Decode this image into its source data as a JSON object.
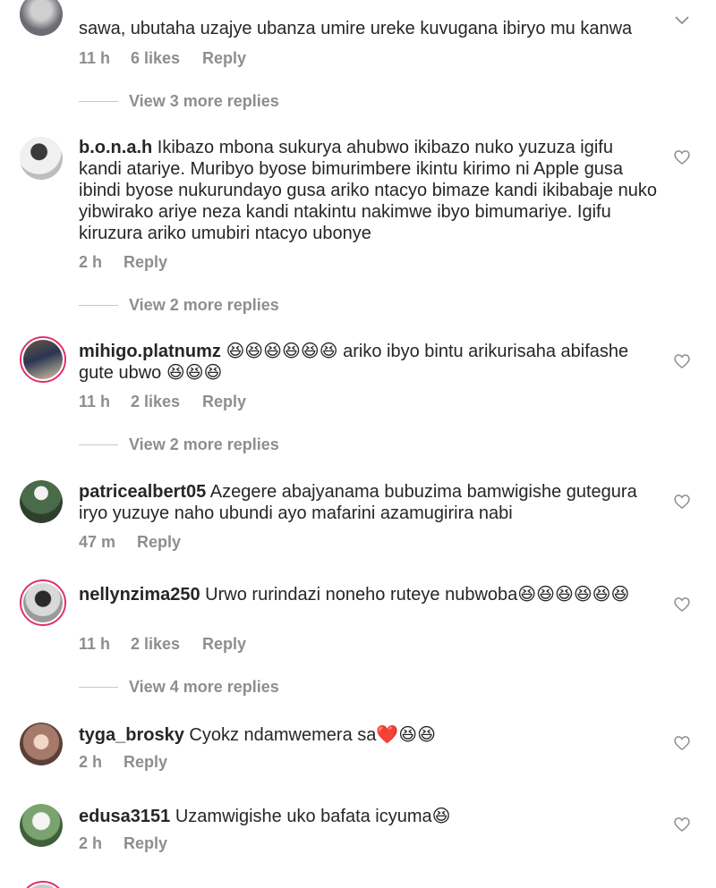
{
  "comments": [
    {
      "username": "",
      "text": "sawa, ubutaha uzajye ubanza umire ureke kuvugana ibiryo mu kanwa",
      "time": "11 h",
      "likes": "6 likes",
      "reply": "Reply",
      "more_replies": "View 3 more replies"
    },
    {
      "username": "b.o.n.a.h",
      "text": " Ikibazo mbona sukurya ahubwo ikibazo nuko yuzuza igifu kandi atariye. Muribyo byose bimurimbere ikintu kirimo ni Apple gusa ibindi byose nukurundayo gusa ariko ntacyo bimaze kandi ikibabaje nuko yibwirako ariye neza kandi ntakintu nakimwe ibyo bimumariye. Igifu kiruzura ariko umubiri ntacyo ubonye",
      "time": "2 h",
      "likes": "",
      "reply": "Reply",
      "more_replies": "View 2 more replies"
    },
    {
      "username": "mihigo.platnumz",
      "text": " 😆😆😆😆😆😆 ariko ibyo bintu arikurisaha abifashe gute ubwo 😆😆😆",
      "time": "11 h",
      "likes": "2 likes",
      "reply": "Reply",
      "more_replies": "View 2 more replies"
    },
    {
      "username": "patricealbert05",
      "text": " Azegere abajyanama bubuzima bamwigishe gutegura iryo yuzuye naho ubundi ayo mafarini azamugirira nabi",
      "time": "47 m",
      "likes": "",
      "reply": "Reply",
      "more_replies": ""
    },
    {
      "username": "nellynzima250",
      "text": " Urwo rurindazi noneho ruteye nubwoba😆😆😆😆😆😆",
      "time": "11 h",
      "likes": "2 likes",
      "reply": "Reply",
      "more_replies": "View 4 more replies"
    },
    {
      "username": "tyga_brosky",
      "text": " Cyokz ndamwemera sa❤️😆😆",
      "time": "2 h",
      "likes": "",
      "reply": "Reply",
      "more_replies": ""
    },
    {
      "username": "edusa3151",
      "text": " Uzamwigishe uko bafata icyuma😆",
      "time": "2 h",
      "likes": "",
      "reply": "Reply",
      "more_replies": ""
    }
  ],
  "colors": {
    "text": "#262626",
    "muted": "#8e8e8e",
    "story_ring": "#e1306c"
  },
  "icons": {
    "like": "heart-outline-icon",
    "collapse": "chevron-down-icon"
  }
}
